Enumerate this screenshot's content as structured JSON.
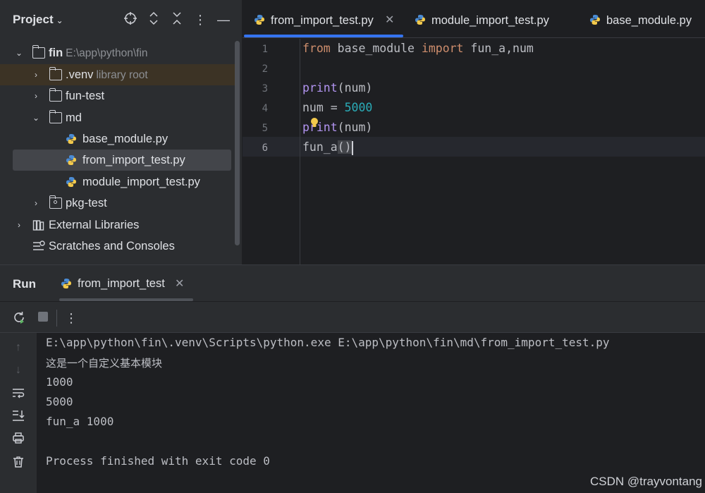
{
  "project_panel": {
    "title": "Project",
    "tree": [
      {
        "label": "fin",
        "hint": "E:\\app\\python\\fin"
      },
      {
        "label": ".venv",
        "hint": "library root"
      },
      {
        "label": "fun-test"
      },
      {
        "label": "md"
      },
      {
        "label": "base_module.py"
      },
      {
        "label": "from_import_test.py"
      },
      {
        "label": "module_import_test.py"
      },
      {
        "label": "pkg-test"
      },
      {
        "label": "External Libraries"
      },
      {
        "label": "Scratches and Consoles"
      }
    ]
  },
  "editor": {
    "tabs": [
      {
        "label": "from_import_test.py",
        "active": true
      },
      {
        "label": "module_import_test.py"
      },
      {
        "label": "base_module.py"
      }
    ],
    "line_numbers": [
      "1",
      "2",
      "3",
      "4",
      "5",
      "6"
    ],
    "code": {
      "line1": {
        "kw1": "from",
        "mod": " base_module ",
        "kw2": "import",
        "rest": " fun_a,num"
      },
      "line3": {
        "fn": "print",
        "rest": "(num)"
      },
      "line4": {
        "lhs": "num = ",
        "num": "5000"
      },
      "line5": {
        "fn": "print",
        "rest": "(num)"
      },
      "line6": {
        "name": "fun_a",
        "paren": "()"
      }
    }
  },
  "run_panel": {
    "title": "Run",
    "tab_label": "from_import_test",
    "console_lines": [
      "E:\\app\\python\\fin\\.venv\\Scripts\\python.exe E:\\app\\python\\fin\\md\\from_import_test.py",
      "这是一个自定义基本模块",
      "1000",
      "5000",
      "fun_a 1000",
      "",
      "Process finished with exit code 0"
    ]
  },
  "watermark": "CSDN @trayvontang",
  "colors": {
    "accent": "#3574f0",
    "keyword": "#cf8e6d",
    "function": "#b294f1",
    "number": "#2aacb8"
  }
}
